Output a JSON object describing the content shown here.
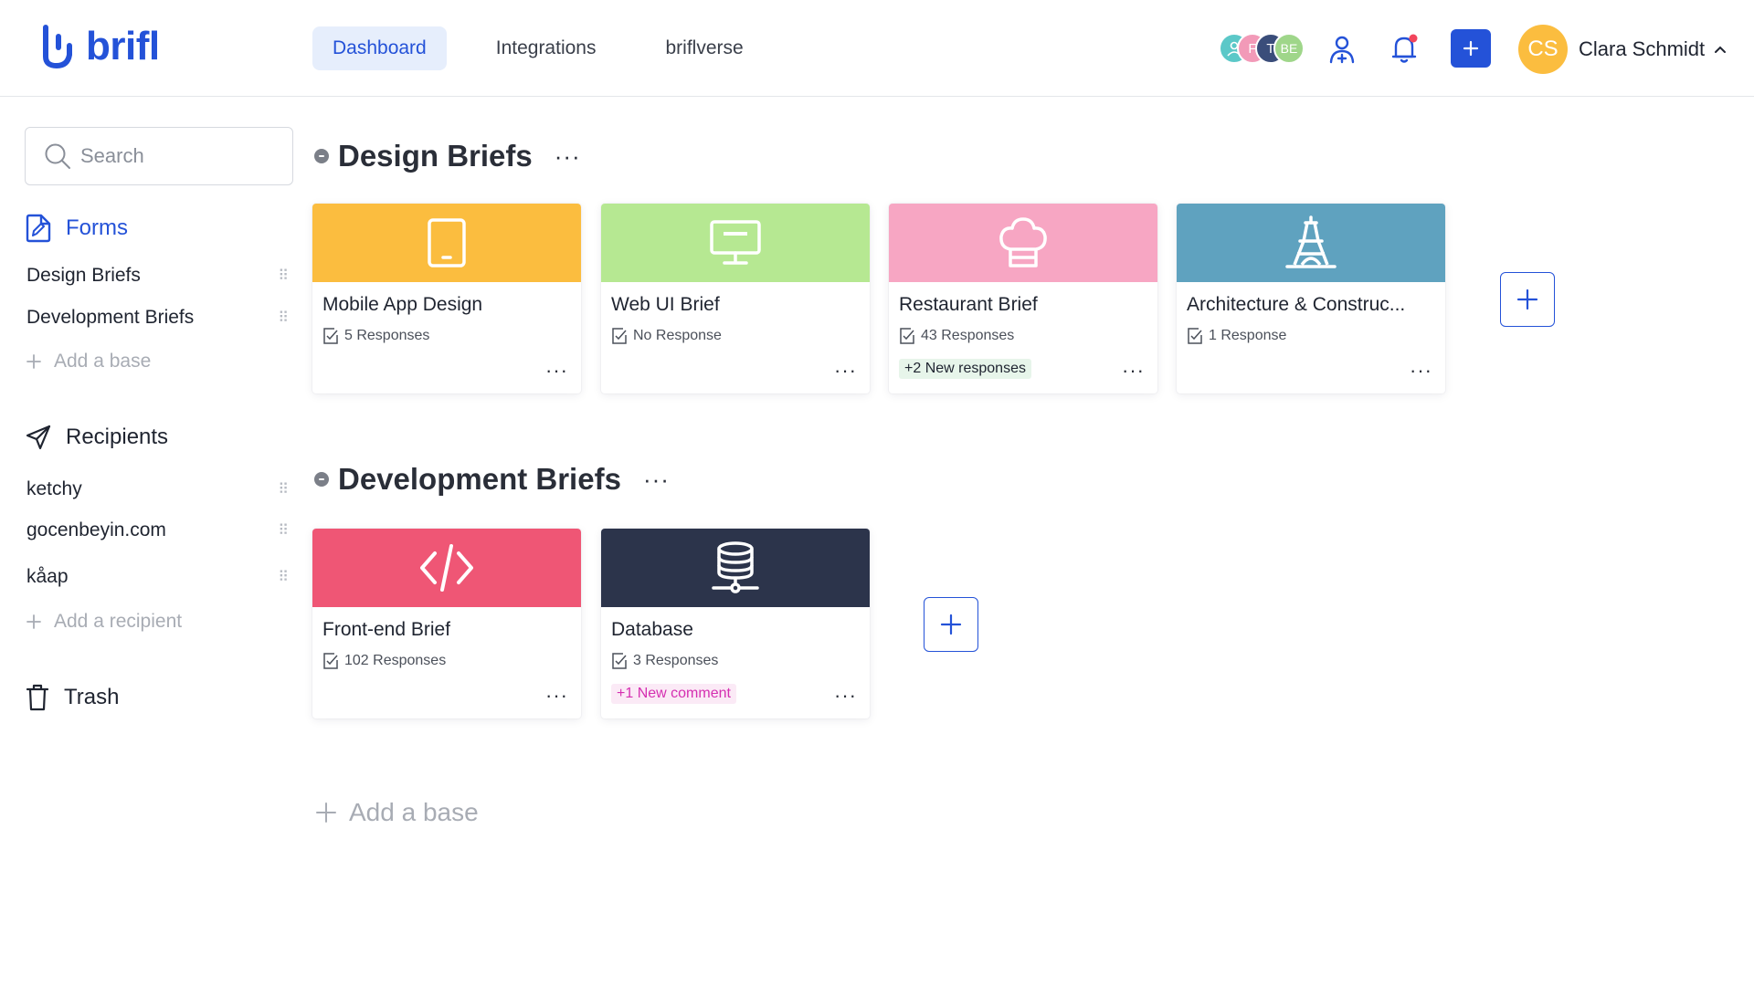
{
  "brand": {
    "name": "brifl",
    "color": "#2452d8"
  },
  "nav": [
    {
      "label": "Dashboard",
      "active": true
    },
    {
      "label": "Integrations",
      "active": false
    },
    {
      "label": "briflverse",
      "active": false
    }
  ],
  "header": {
    "collaborators": [
      {
        "initials": "",
        "color": "#5bc8c8",
        "icon": "person-icon"
      },
      {
        "initials": "F",
        "color": "#f29ab8"
      },
      {
        "initials": "T",
        "color": "#3a4d7a"
      },
      {
        "initials": "BE",
        "color": "#9fd68a"
      }
    ],
    "user": {
      "initials": "CS",
      "name": "Clara Schmidt",
      "avatar_color": "#fbbd3f"
    }
  },
  "sidebar": {
    "search": {
      "placeholder": "Search",
      "value": ""
    },
    "forms": {
      "title": "Forms",
      "items": [
        "Design Briefs",
        "Development Briefs"
      ],
      "add_label": "Add a base"
    },
    "recipients": {
      "title": "Recipients",
      "items": [
        "ketchy",
        "gocenbeyin.com",
        "kåap"
      ],
      "add_label": "Add a recipient"
    },
    "trash": {
      "title": "Trash"
    }
  },
  "groups": [
    {
      "name": "Design Briefs",
      "cards": [
        {
          "title": "Mobile App Design",
          "responses": "5 Responses",
          "badge": "",
          "color": "#fbbd3f",
          "icon": "tablet-icon"
        },
        {
          "title": "Web UI Brief",
          "responses": "No Response",
          "badge": "",
          "color": "#b6e892",
          "icon": "monitor-icon"
        },
        {
          "title": "Restaurant Brief",
          "responses": "43 Responses",
          "badge": "+2 New responses",
          "color": "#f7a6c3",
          "icon": "chef-hat-icon"
        },
        {
          "title": "Architecture & Construc...",
          "responses": "1 Response",
          "badge": "",
          "color": "#5fa2bf",
          "icon": "eiffel-tower-icon"
        }
      ]
    },
    {
      "name": "Development Briefs",
      "cards": [
        {
          "title": "Front-end Brief",
          "responses": "102 Responses",
          "badge": "",
          "color": "#ef5675",
          "icon": "code-icon"
        },
        {
          "title": "Database",
          "responses": "3 Responses",
          "badge": "+1 New comment",
          "color": "#2c344b",
          "icon": "database-icon"
        }
      ]
    }
  ],
  "main": {
    "add_base_label": "Add a base"
  }
}
